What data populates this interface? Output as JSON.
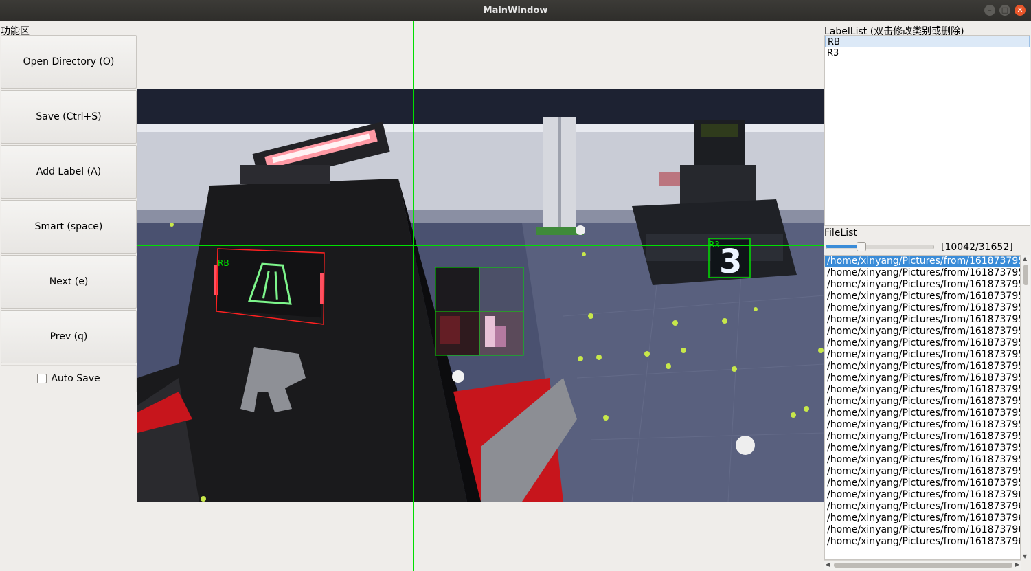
{
  "window": {
    "title": "MainWindow"
  },
  "left_panel": {
    "title": "功能区",
    "buttons": {
      "open": "Open Directory (O)",
      "save": "Save (Ctrl+S)",
      "add_label": "Add Label (A)",
      "smart": "Smart (space)",
      "next": "Next (e)",
      "prev": "Prev (q)"
    },
    "auto_save": {
      "label": "Auto Save",
      "checked": false
    }
  },
  "canvas": {
    "annotations": [
      {
        "label": "RB",
        "color": "#ff2020"
      },
      {
        "label": "R3",
        "color": "#00e000"
      }
    ],
    "crosshair_color": "#00e000"
  },
  "label_list": {
    "title": "LabelList (双击修改类别或删除)",
    "items": [
      "RB",
      "R3"
    ],
    "selected": "RB"
  },
  "file_list": {
    "title": "FileList",
    "counter": "[10042/31652]",
    "progress": 0.317,
    "items": [
      "/home/xinyang/Pictures/from/161873795",
      "/home/xinyang/Pictures/from/161873795",
      "/home/xinyang/Pictures/from/161873795",
      "/home/xinyang/Pictures/from/161873795",
      "/home/xinyang/Pictures/from/161873795",
      "/home/xinyang/Pictures/from/161873795",
      "/home/xinyang/Pictures/from/161873795",
      "/home/xinyang/Pictures/from/161873795",
      "/home/xinyang/Pictures/from/161873795",
      "/home/xinyang/Pictures/from/161873795",
      "/home/xinyang/Pictures/from/161873795",
      "/home/xinyang/Pictures/from/161873795",
      "/home/xinyang/Pictures/from/161873795",
      "/home/xinyang/Pictures/from/161873795",
      "/home/xinyang/Pictures/from/161873795",
      "/home/xinyang/Pictures/from/161873795",
      "/home/xinyang/Pictures/from/161873795",
      "/home/xinyang/Pictures/from/161873795",
      "/home/xinyang/Pictures/from/161873795",
      "/home/xinyang/Pictures/from/161873795",
      "/home/xinyang/Pictures/from/161873796",
      "/home/xinyang/Pictures/from/161873796",
      "/home/xinyang/Pictures/from/161873796",
      "/home/xinyang/Pictures/from/161873796",
      "/home/xinyang/Pictures/from/161873796"
    ]
  }
}
